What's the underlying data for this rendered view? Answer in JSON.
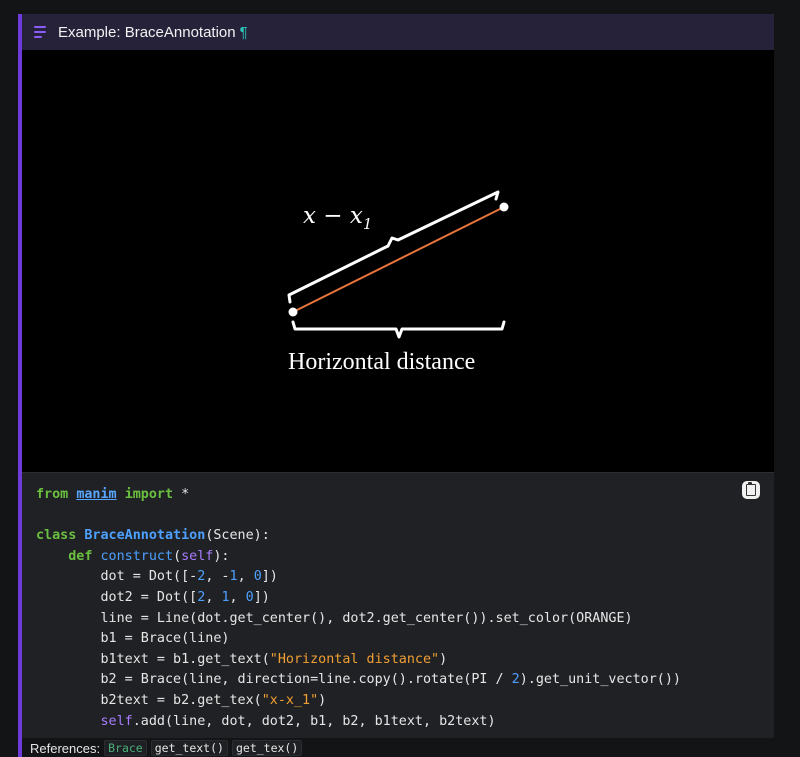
{
  "header": {
    "title": "Example: BraceAnnotation",
    "anchor": "¶"
  },
  "video": {
    "label_top": "x − x",
    "label_top_sub": "1",
    "label_bottom": "Horizontal distance",
    "line_color": "#e8743c"
  },
  "code": {
    "copy_icon": "clipboard-icon",
    "lines": [
      "from manim import *",
      "",
      "class BraceAnnotation(Scene):",
      "    def construct(self):",
      "        dot = Dot([-2, -1, 0])",
      "        dot2 = Dot([2, 1, 0])",
      "        line = Line(dot.get_center(), dot2.get_center()).set_color(ORANGE)",
      "        b1 = Brace(line)",
      "        b1text = b1.get_text(\"Horizontal distance\")",
      "        b2 = Brace(line, direction=line.copy().rotate(PI / 2).get_unit_vector())",
      "        b2text = b2.get_tex(\"x-x_1\")",
      "        self.add(line, dot, dot2, b1, b2, b1text, b2text)"
    ]
  },
  "references": {
    "label": "References:",
    "items": [
      "Brace",
      "get_text()",
      "get_tex()"
    ]
  },
  "colors": {
    "accent": "#6c3bd9",
    "header_bg": "#25223a",
    "code_bg": "#202124"
  }
}
